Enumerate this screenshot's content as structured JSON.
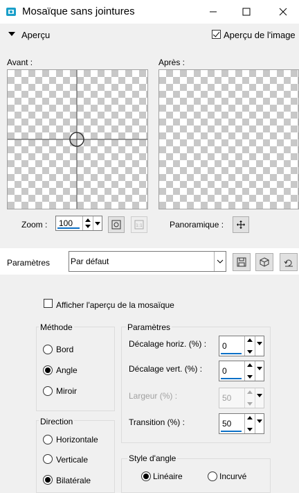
{
  "window": {
    "title": "Mosaïque sans jointures",
    "minimize_icon": "minimize-icon",
    "maximize_icon": "maximize-icon",
    "close_icon": "close-icon"
  },
  "preview_section": {
    "label": "Aperçu",
    "image_preview_label": "Aperçu de l'image",
    "image_preview_checked": true
  },
  "panels": {
    "before_label": "Avant :",
    "after_label": "Après :"
  },
  "zoom": {
    "label": "Zoom :",
    "value": "100"
  },
  "pan": {
    "label": "Panoramique :"
  },
  "presets": {
    "label": "Paramètres",
    "selected": "Par défaut"
  },
  "show_tile_preview": {
    "label": "Afficher l'aperçu de la mosaïque",
    "checked": false
  },
  "method": {
    "title": "Méthode",
    "options": [
      "Bord",
      "Angle",
      "Miroir"
    ],
    "selected": "Angle"
  },
  "params": {
    "title": "Paramètres",
    "h_offset": {
      "label": "Décalage horiz. (%) :",
      "value": "0"
    },
    "v_offset": {
      "label": "Décalage vert. (%) :",
      "value": "0"
    },
    "width": {
      "label": "Largeur (%) :",
      "value": "50",
      "disabled": true
    },
    "transition": {
      "label": "Transition (%) :",
      "value": "50"
    }
  },
  "direction": {
    "title": "Direction",
    "options": [
      "Horizontale",
      "Verticale",
      "Bilatérale"
    ],
    "selected": "Bilatérale"
  },
  "corner_style": {
    "title": "Style d'angle",
    "options": [
      "Linéaire",
      "Incurvé"
    ],
    "selected": "Linéaire"
  },
  "colors": {
    "accent": "#0b6fc6",
    "checker": "#c8c8c8",
    "icon_teal": "#1a9fc9"
  }
}
